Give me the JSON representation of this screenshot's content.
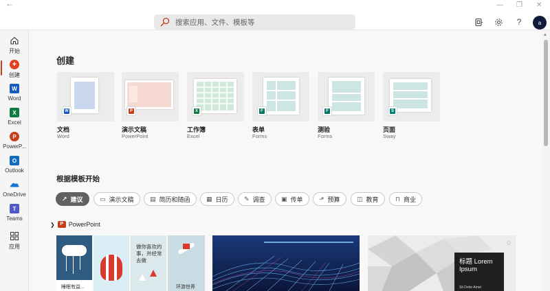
{
  "search": {
    "placeholder": "搜索应用、文件、模板等"
  },
  "titlebar": {
    "back_icon": "back-arrow-icon",
    "minimize_icon": "minimize-icon",
    "maximize_icon": "maximize-icon",
    "close_icon": "close-icon",
    "help_label": "?"
  },
  "user": {
    "avatar_initial": "a"
  },
  "sidebar": {
    "items": [
      {
        "label": "开始",
        "icon": "home-icon"
      },
      {
        "label": "创建",
        "icon": "create-plus-icon"
      },
      {
        "label": "Word",
        "icon": "word-icon"
      },
      {
        "label": "Excel",
        "icon": "excel-icon"
      },
      {
        "label": "PowerP...",
        "icon": "powerpoint-icon"
      },
      {
        "label": "Outlook",
        "icon": "outlook-icon"
      },
      {
        "label": "OneDrive",
        "icon": "onedrive-icon"
      },
      {
        "label": "Teams",
        "icon": "teams-icon"
      },
      {
        "label": "应用",
        "icon": "apps-icon"
      }
    ]
  },
  "create": {
    "title": "创建",
    "cards": [
      {
        "label": "文档",
        "app": "Word"
      },
      {
        "label": "演示文稿",
        "app": "PowerPoint"
      },
      {
        "label": "工作簿",
        "app": "Excel"
      },
      {
        "label": "表单",
        "app": "Forms"
      },
      {
        "label": "测验",
        "app": "Forms"
      },
      {
        "label": "页面",
        "app": "Sway"
      }
    ]
  },
  "templates": {
    "title": "根据模板开始",
    "chips": [
      {
        "label": "建议",
        "icon": "trend-icon"
      },
      {
        "label": "演示文稿",
        "icon": "monitor-icon"
      },
      {
        "label": "简历和随函",
        "icon": "id-card-icon"
      },
      {
        "label": "日历",
        "icon": "calendar-icon"
      },
      {
        "label": "调查",
        "icon": "survey-icon"
      },
      {
        "label": "传单",
        "icon": "flyer-icon"
      },
      {
        "label": "预算",
        "icon": "chart-icon"
      },
      {
        "label": "教育",
        "icon": "book-icon"
      },
      {
        "label": "商业",
        "icon": "briefcase-icon"
      }
    ],
    "group_label": "PowerPoint",
    "thumb1": {
      "panel1": "睡眠有益...",
      "panel3": "做你喜欢的事，并经常去做",
      "panel4": "环游世界"
    },
    "thumb3": {
      "title": "标题 Lorem Ipsum",
      "subtitle": "Sit Dolor Amet"
    }
  }
}
